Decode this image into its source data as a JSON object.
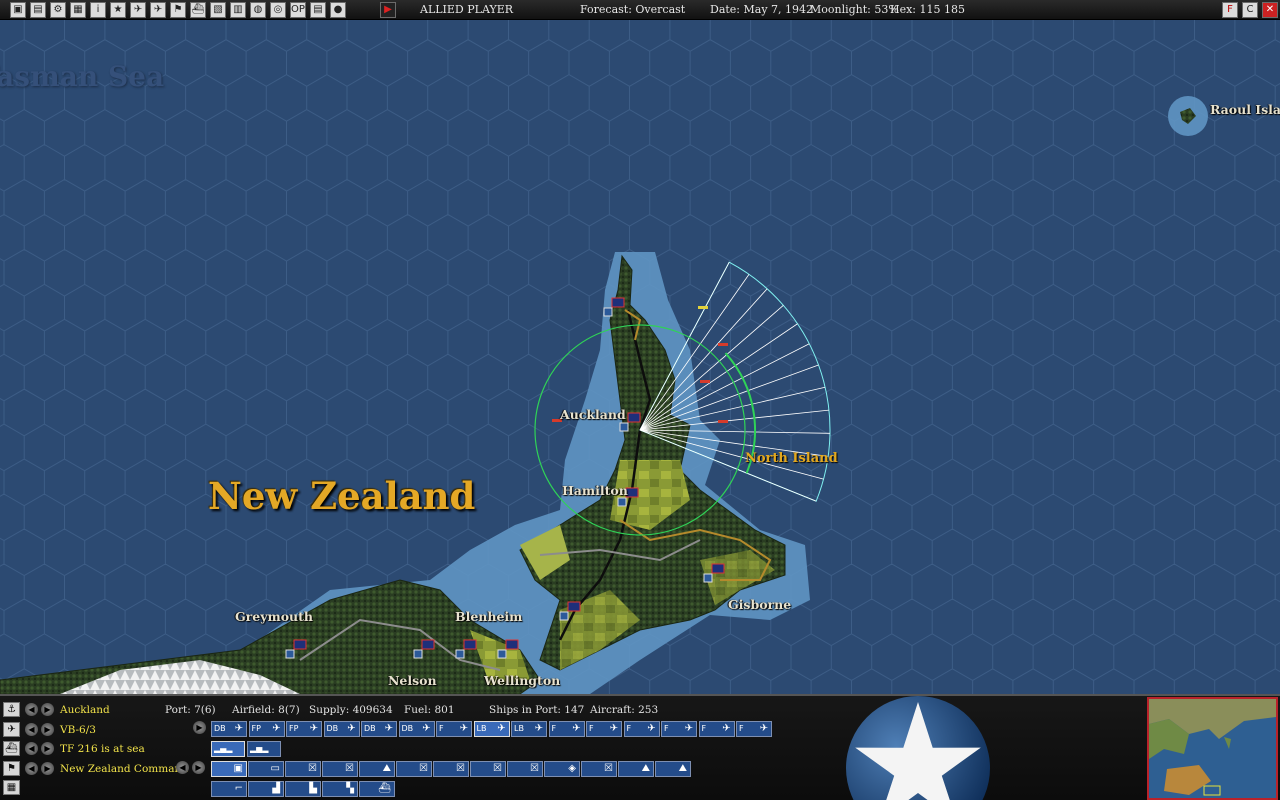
{
  "topbar": {
    "player": "ALLIED PLAYER",
    "forecast": "Forecast: Overcast",
    "date": "Date: May 7, 1942",
    "moonlight": "Moonlight: 53%",
    "hex": "Hex: 115 185",
    "right_buttons": [
      "F",
      "C",
      "✕"
    ],
    "icons": [
      "display-icon",
      "list-icon",
      "gear-icon",
      "screen-icon",
      "info-icon",
      "star-icon",
      "plane-icon",
      "fighter-icon",
      "flag-icon",
      "ship-icon",
      "map-icon",
      "supply-icon",
      "globe-icon",
      "target-icon",
      "op-icon",
      "report-icon",
      "camera-icon",
      "play-icon"
    ],
    "icon_glyphs": [
      "▣",
      "▤",
      "⚙",
      "▦",
      "i",
      "★",
      "✈",
      "✈",
      "⚑",
      "⛴",
      "▧",
      "▥",
      "◍",
      "◎",
      "OP",
      "▤",
      "●",
      "▶"
    ]
  },
  "map": {
    "sea_label": "Tasman Sea",
    "country_label": "New Zealand",
    "region_label": "North Island",
    "towns": [
      "Auckland",
      "Hamilton",
      "Gisborne",
      "Greymouth",
      "Blenheim",
      "Nelson",
      "Wellington",
      "Raoul Island"
    ]
  },
  "panel": {
    "rows": [
      {
        "icon": "anchor-icon",
        "glyph": "⚓",
        "label": "Auckland"
      },
      {
        "icon": "aircraft-icon",
        "glyph": "✈",
        "label": "VB-6/3"
      },
      {
        "icon": "taskforce-icon",
        "glyph": "⛴",
        "label": "TF 216 is at sea"
      },
      {
        "icon": "command-flag-icon",
        "glyph": "⚑",
        "label": "New Zealand Command"
      },
      {
        "icon": "leader-icon",
        "glyph": "▦",
        "label": ""
      }
    ],
    "stats": [
      "Port: 7(6)",
      "Airfield: 8(7)",
      "Supply: 409634",
      "Fuel: 801",
      "Ships in Port: 147",
      "Aircraft: 253"
    ],
    "air_buttons": [
      "DB",
      "FP",
      "FP",
      "DB",
      "DB",
      "DB",
      "F",
      "LB",
      "LB",
      "F",
      "F",
      "F",
      "F",
      "F",
      "F"
    ],
    "selected_air": 7,
    "ground_buttons": [
      "inf",
      "inf",
      "base",
      "base",
      "art",
      "base",
      "base",
      "base",
      "base",
      "hq",
      "base",
      "art",
      "art"
    ],
    "ship_buttons": [
      "cv",
      "bb",
      "ca",
      "dd",
      "tf"
    ]
  },
  "colors": {
    "sea": "#2c4a72",
    "hex_line": "#3d5d86",
    "range_circle": "#2fd257",
    "search_arc": "#7ff0f0",
    "label_gold": "#e4a826",
    "label_yellow": "#f1e24a"
  }
}
